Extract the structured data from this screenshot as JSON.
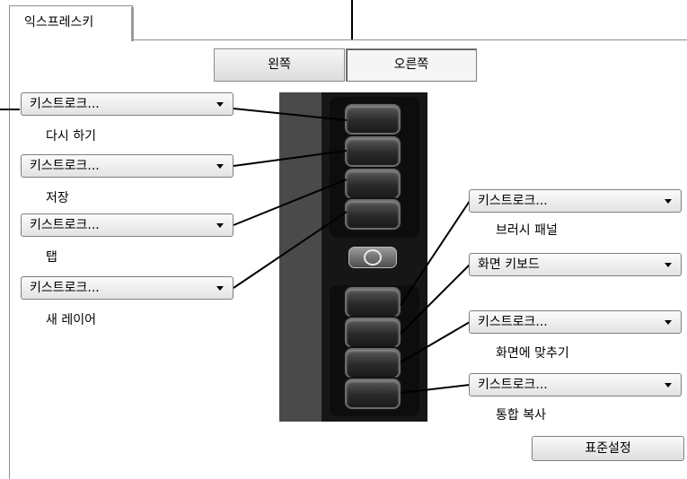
{
  "tab": {
    "label": "익스프레스키"
  },
  "side": {
    "left_label": "왼쪽",
    "right_label": "오른쪽"
  },
  "left_keys": [
    {
      "value": "키스트로크...",
      "caption": "다시 하기"
    },
    {
      "value": "키스트로크...",
      "caption": "저장"
    },
    {
      "value": "키스트로크...",
      "caption": "탭"
    },
    {
      "value": "키스트로크...",
      "caption": "새 레이어"
    }
  ],
  "right_keys": [
    {
      "value": "키스트로크...",
      "caption": "브러시 패널"
    },
    {
      "value": "화면 키보드",
      "caption": ""
    },
    {
      "value": "키스트로크...",
      "caption": "화면에 맞추기"
    },
    {
      "value": "키스트로크...",
      "caption": "통합 복사"
    }
  ],
  "default_button": {
    "label": "표준설정"
  }
}
